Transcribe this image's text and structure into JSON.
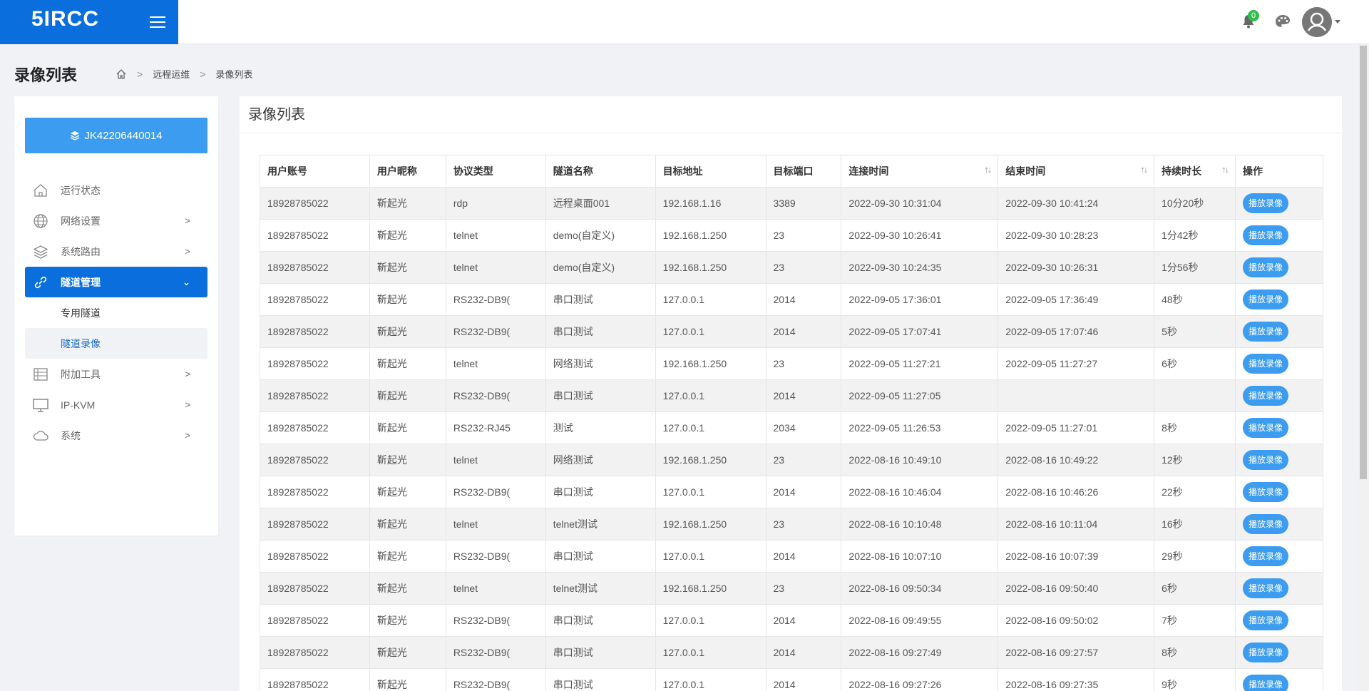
{
  "header": {
    "logo_text": "5IRCC",
    "notification_count": "0"
  },
  "page": {
    "title": "录像列表",
    "breadcrumb": [
      "远程运维",
      "录像列表"
    ]
  },
  "sidebar": {
    "device_id": "JK42206440014",
    "items": [
      {
        "label": "运行状态",
        "icon": "dashboard-icon"
      },
      {
        "label": "网络设置",
        "icon": "globe-icon"
      },
      {
        "label": "系统路由",
        "icon": "layers-icon"
      },
      {
        "label": "隧道管理",
        "icon": "link-icon"
      },
      {
        "label": "附加工具",
        "icon": "toolbox-icon"
      },
      {
        "label": "IP-KVM",
        "icon": "monitor-icon"
      },
      {
        "label": "系统",
        "icon": "cloud-icon"
      }
    ],
    "sub_items": [
      "专用隧道",
      "隧道录像"
    ]
  },
  "main": {
    "title": "录像列表",
    "columns": [
      "用户账号",
      "用户昵称",
      "协议类型",
      "隧道名称",
      "目标地址",
      "目标端口",
      "连接时间",
      "结束时间",
      "持续时长",
      "操作"
    ],
    "play_label": "播放录像",
    "rows": [
      [
        "18928785022",
        "靳起光",
        "rdp",
        "远程桌面001",
        "192.168.1.16",
        "3389",
        "2022-09-30 10:31:04",
        "2022-09-30 10:41:24",
        "10分20秒"
      ],
      [
        "18928785022",
        "靳起光",
        "telnet",
        "demo(自定义)",
        "192.168.1.250",
        "23",
        "2022-09-30 10:26:41",
        "2022-09-30 10:28:23",
        "1分42秒"
      ],
      [
        "18928785022",
        "靳起光",
        "telnet",
        "demo(自定义)",
        "192.168.1.250",
        "23",
        "2022-09-30 10:24:35",
        "2022-09-30 10:26:31",
        "1分56秒"
      ],
      [
        "18928785022",
        "靳起光",
        "RS232-DB9(",
        "串口测试",
        "127.0.0.1",
        "2014",
        "2022-09-05 17:36:01",
        "2022-09-05 17:36:49",
        "48秒"
      ],
      [
        "18928785022",
        "靳起光",
        "RS232-DB9(",
        "串口测试",
        "127.0.0.1",
        "2014",
        "2022-09-05 17:07:41",
        "2022-09-05 17:07:46",
        "5秒"
      ],
      [
        "18928785022",
        "靳起光",
        "telnet",
        "网络测试",
        "192.168.1.250",
        "23",
        "2022-09-05 11:27:21",
        "2022-09-05 11:27:27",
        "6秒"
      ],
      [
        "18928785022",
        "靳起光",
        "RS232-DB9(",
        "串口测试",
        "127.0.0.1",
        "2014",
        "2022-09-05 11:27:05",
        "",
        ""
      ],
      [
        "18928785022",
        "靳起光",
        "RS232-RJ45",
        "测试",
        "127.0.0.1",
        "2034",
        "2022-09-05 11:26:53",
        "2022-09-05 11:27:01",
        "8秒"
      ],
      [
        "18928785022",
        "靳起光",
        "telnet",
        "网络测试",
        "192.168.1.250",
        "23",
        "2022-08-16 10:49:10",
        "2022-08-16 10:49:22",
        "12秒"
      ],
      [
        "18928785022",
        "靳起光",
        "RS232-DB9(",
        "串口测试",
        "127.0.0.1",
        "2014",
        "2022-08-16 10:46:04",
        "2022-08-16 10:46:26",
        "22秒"
      ],
      [
        "18928785022",
        "靳起光",
        "telnet",
        "telnet测试",
        "192.168.1.250",
        "23",
        "2022-08-16 10:10:48",
        "2022-08-16 10:11:04",
        "16秒"
      ],
      [
        "18928785022",
        "靳起光",
        "RS232-DB9(",
        "串口测试",
        "127.0.0.1",
        "2014",
        "2022-08-16 10:07:10",
        "2022-08-16 10:07:39",
        "29秒"
      ],
      [
        "18928785022",
        "靳起光",
        "telnet",
        "telnet测试",
        "192.168.1.250",
        "23",
        "2022-08-16 09:50:34",
        "2022-08-16 09:50:40",
        "6秒"
      ],
      [
        "18928785022",
        "靳起光",
        "RS232-DB9(",
        "串口测试",
        "127.0.0.1",
        "2014",
        "2022-08-16 09:49:55",
        "2022-08-16 09:50:02",
        "7秒"
      ],
      [
        "18928785022",
        "靳起光",
        "RS232-DB9(",
        "串口测试",
        "127.0.0.1",
        "2014",
        "2022-08-16 09:27:49",
        "2022-08-16 09:27:57",
        "8秒"
      ],
      [
        "18928785022",
        "靳起光",
        "RS232-DB9(",
        "串口测试",
        "127.0.0.1",
        "2014",
        "2022-08-16 09:27:26",
        "2022-08-16 09:27:35",
        "9秒"
      ]
    ]
  },
  "colors": {
    "brand_blue": "#0a6fdc",
    "button_blue": "#3b9cf0",
    "badge_green": "#2fbf4b"
  }
}
